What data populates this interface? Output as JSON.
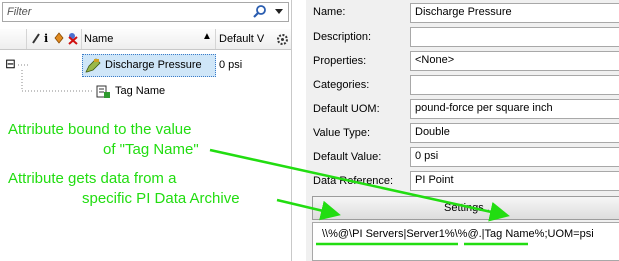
{
  "filter": {
    "placeholder": "Filter",
    "search_icon": "search-icon",
    "dropdown_icon": "chevron-down-icon"
  },
  "grid": {
    "columns": {
      "name": "Name",
      "default_value": "Default V"
    },
    "rows": [
      {
        "name": "Discharge Pressure",
        "value": "0 psi",
        "expand": "⊟"
      },
      {
        "name": "Tag Name",
        "value": ""
      }
    ]
  },
  "properties": {
    "name_label": "Name:",
    "name_value": "Discharge Pressure",
    "description_label": "Description:",
    "description_value": "",
    "properties_label": "Properties:",
    "properties_value": "<None>",
    "categories_label": "Categories:",
    "categories_value": "",
    "uom_label": "Default UOM:",
    "uom_value": "pound-force per square inch",
    "value_type_label": "Value Type:",
    "value_type_value": "Double",
    "default_value_label": "Default Value:",
    "default_value_value": "0 psi",
    "data_reference_label": "Data Reference:",
    "data_reference_value": "PI Point",
    "settings_label": "Settings...",
    "config_string": "\\\\%@\\PI Servers|Server1%\\%@.|Tag Name%;UOM=psi"
  },
  "annotations": {
    "a1_line1": "Attribute bound to the value",
    "a1_line2": "of \"Tag Name\"",
    "a2_line1": "Attribute gets data from a",
    "a2_line2": "specific PI Data Archive"
  },
  "colors": {
    "annotation": "#22dd11",
    "selection": "#cfe6f8",
    "panel": "#f0f0f0"
  }
}
